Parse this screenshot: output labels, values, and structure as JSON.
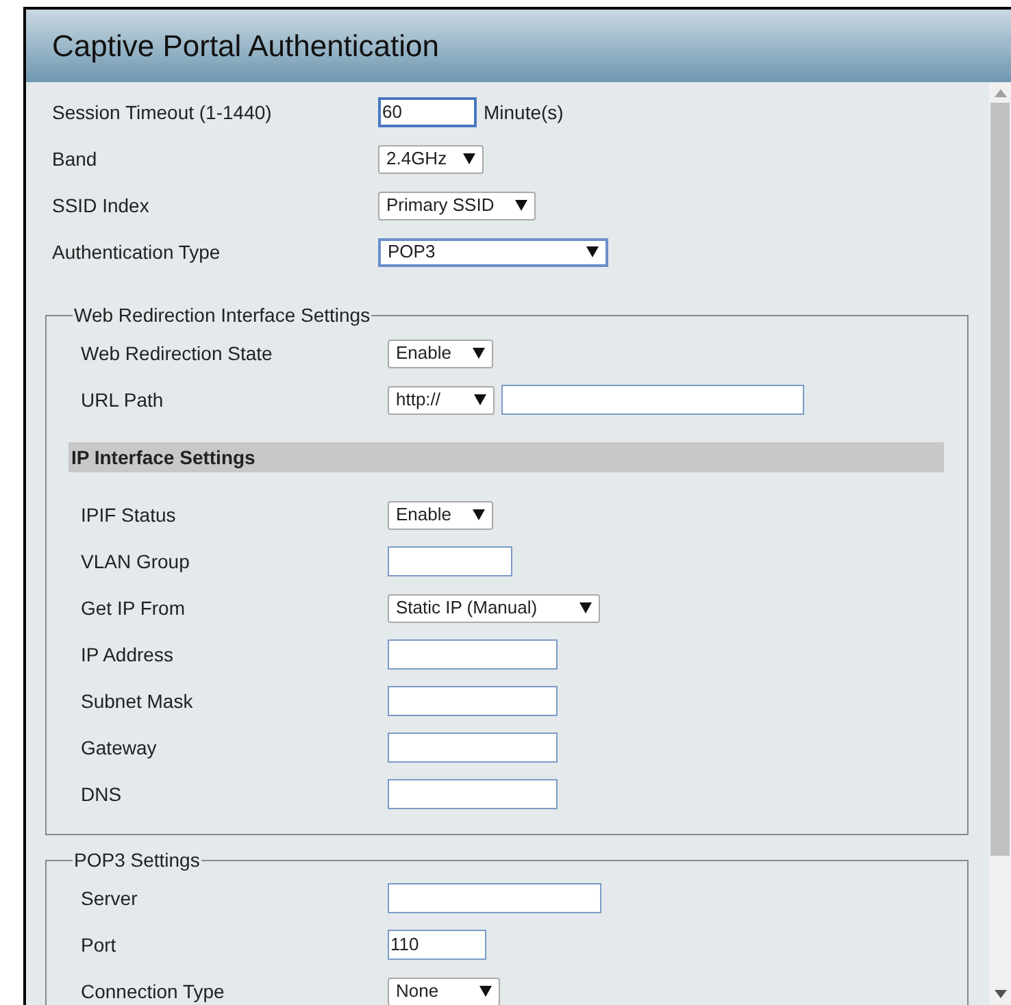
{
  "window": {
    "title": "Captive Portal Authentication"
  },
  "fields": [
    {
      "label": "Session Timeout (1-1440)",
      "kind": "text_input",
      "value": "60",
      "unit": "Minute(s)",
      "focused": true
    },
    {
      "label": "Band",
      "kind": "select",
      "value": "2.4GHz"
    },
    {
      "label": "SSID Index",
      "kind": "select",
      "value": "Primary SSID"
    },
    {
      "label": "Authentication Type",
      "kind": "select",
      "value": "POP3",
      "focused": true
    }
  ],
  "sections": [
    {
      "legend": "Web Redirection Interface Settings",
      "rows": [
        {
          "kind": "select",
          "label": "Web Redirection State",
          "value": "Enable"
        },
        {
          "kind": "select_input",
          "label": "URL Path",
          "value": "http://"
        },
        {
          "kind": "heading",
          "label": "IP Interface Settings"
        },
        {
          "kind": "select",
          "label": "IPIF Status",
          "value": "Enable"
        },
        {
          "kind": "text_input",
          "label": "VLAN Group"
        },
        {
          "kind": "select",
          "label": "Get IP From",
          "value": "Static IP (Manual)"
        },
        {
          "kind": "text_input",
          "label": "IP Address"
        },
        {
          "kind": "text_input",
          "label": "Subnet Mask"
        },
        {
          "kind": "text_input",
          "label": "Gateway"
        },
        {
          "kind": "text_input",
          "label": "DNS"
        }
      ]
    },
    {
      "legend": "POP3 Settings",
      "rows": [
        {
          "kind": "text_input",
          "label": "Server"
        },
        {
          "kind": "text_input",
          "label": "Port",
          "value": "110"
        },
        {
          "kind": "select",
          "label": "Connection Type",
          "value": "None"
        }
      ]
    }
  ]
}
